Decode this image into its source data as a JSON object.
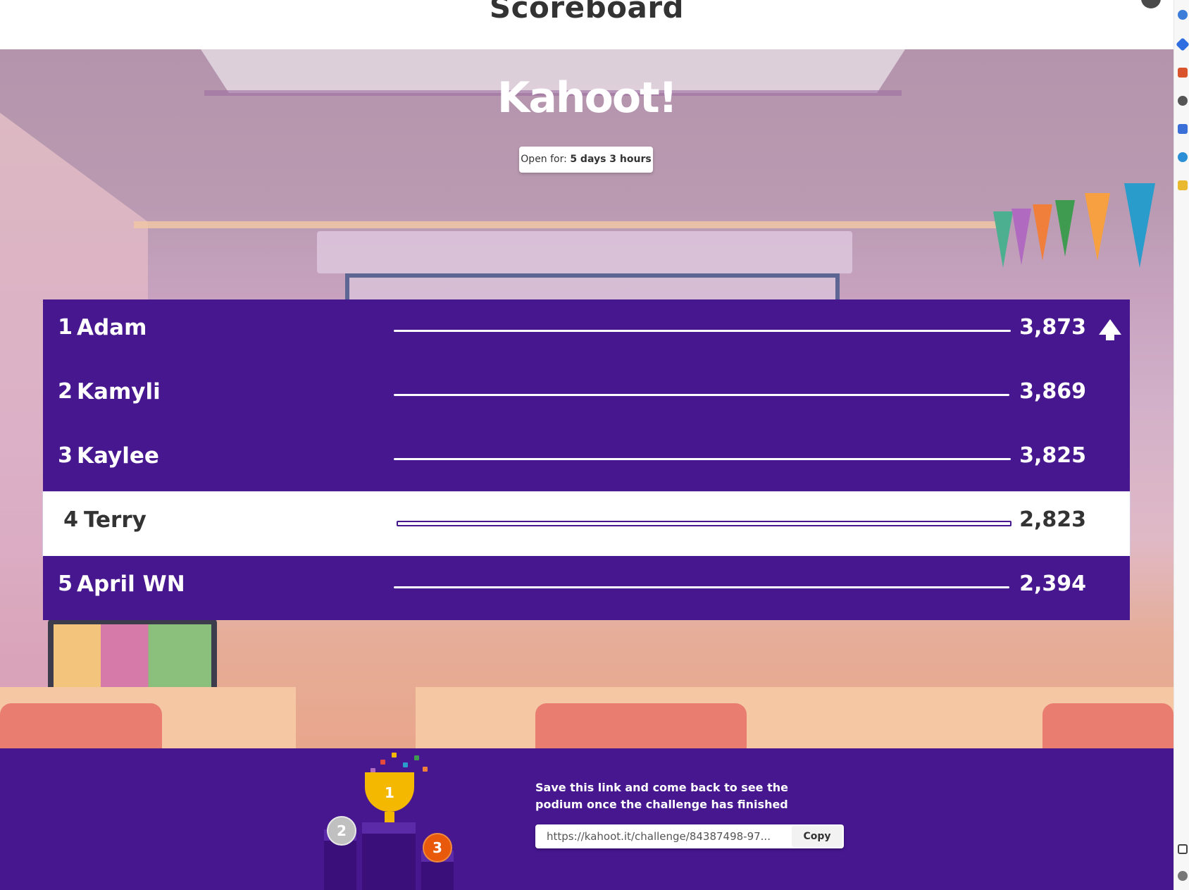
{
  "header": {
    "title": "Scoreboard"
  },
  "brand": {
    "logo": "Kahoot!"
  },
  "timer": {
    "label": "Open for:",
    "value": "5 days 3 hours"
  },
  "scoreboard": [
    {
      "rank": "1",
      "name": "Adam",
      "score": "3,873",
      "trend": "up-arrow-icon",
      "bar": 1.0
    },
    {
      "rank": "2",
      "name": "Kamyli",
      "score": "3,869",
      "trend": null,
      "bar": 0.996
    },
    {
      "rank": "3",
      "name": "Kaylee",
      "score": "3,825",
      "trend": null,
      "bar": 0.999
    },
    {
      "rank": "4",
      "name": "Terry",
      "score": "2,823",
      "trend": null,
      "bar": 0.995,
      "highlighted": true
    },
    {
      "rank": "5",
      "name": "April WN",
      "score": "2,394",
      "trend": null,
      "bar": 0.997
    }
  ],
  "footer": {
    "message": "Save this link and come back to see the podium once the challenge has finished",
    "link": "https://kahoot.it/challenge/84387498-97...",
    "copy_label": "Copy",
    "medals": [
      "2",
      "1",
      "3"
    ]
  },
  "colors": {
    "primary": "#46178f",
    "highlight_row": "#ffffff",
    "gold": "#f5b800",
    "silver": "#c0c0c0",
    "bronze": "#e8590c"
  }
}
